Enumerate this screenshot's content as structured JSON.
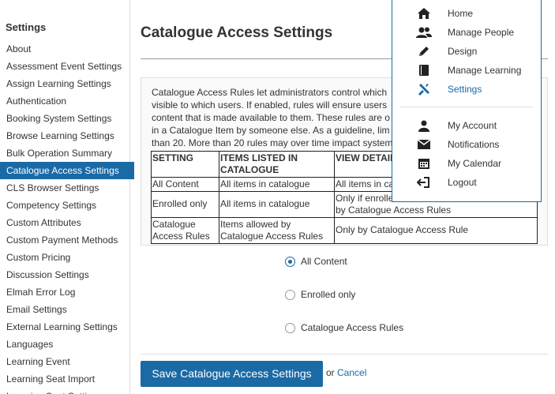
{
  "sidebar": {
    "title": "Settings",
    "items": [
      {
        "label": "About"
      },
      {
        "label": "Assessment Event Settings"
      },
      {
        "label": "Assign Learning Settings"
      },
      {
        "label": "Authentication"
      },
      {
        "label": "Booking System Settings"
      },
      {
        "label": "Browse Learning Settings"
      },
      {
        "label": "Bulk Operation Summary"
      },
      {
        "label": "Catalogue Access Settings",
        "active": true
      },
      {
        "label": "CLS Browser Settings"
      },
      {
        "label": "Competency Settings"
      },
      {
        "label": "Custom Attributes"
      },
      {
        "label": "Custom Payment Methods"
      },
      {
        "label": "Custom Pricing"
      },
      {
        "label": "Discussion Settings"
      },
      {
        "label": "Elmah Error Log"
      },
      {
        "label": "Email Settings"
      },
      {
        "label": "External Learning Settings"
      },
      {
        "label": "Languages"
      },
      {
        "label": "Learning Event"
      },
      {
        "label": "Learning Seat Import"
      },
      {
        "label": "Learning Seat Settings"
      }
    ]
  },
  "main": {
    "title": "Catalogue Access Settings",
    "info_lines": [
      "Catalogue Access Rules let administrators control which",
      "visible to which users. If enabled, rules will ensure users",
      "content that is made available to them. These rules are o",
      "in a Catalogue Item by someone else. As a guideline, lim",
      "than 20. More than 20 rules may over time impact system"
    ],
    "table": {
      "headers": [
        "SETTING",
        "ITEMS LISTED IN CATALOGUE",
        "VIEW DETAIL"
      ],
      "rows": [
        {
          "setting": "All Content",
          "items": "All items in catalogue",
          "view": [
            "All items in ca"
          ]
        },
        {
          "setting": "Enrolled only",
          "items": "All items in catalogue",
          "view": [
            "Only if enrolle",
            "by Catalogue Access Rules"
          ]
        },
        {
          "setting": "Catalogue Access Rules",
          "items": "Items allowed by Catalogue Access Rules",
          "view": [
            "Only by Catalogue Access Rule"
          ]
        }
      ]
    },
    "options": [
      {
        "label": "All Content",
        "checked": true
      },
      {
        "label": "Enrolled only",
        "checked": false
      },
      {
        "label": "Catalogue Access Rules",
        "checked": false
      }
    ],
    "save_label": "Save Catalogue Access Settings",
    "or_text": "or",
    "cancel_label": "Cancel"
  },
  "menu": {
    "items": [
      {
        "label": "Home",
        "icon": "home-icon"
      },
      {
        "label": "Manage People",
        "icon": "users-icon"
      },
      {
        "label": "Design",
        "icon": "pencil-icon"
      },
      {
        "label": "Manage Learning",
        "icon": "book-icon"
      },
      {
        "label": "Settings",
        "icon": "wrench-icon",
        "active": true
      },
      {
        "label": "My Account",
        "icon": "user-icon"
      },
      {
        "label": "Notifications",
        "icon": "envelope-icon"
      },
      {
        "label": "My Calendar",
        "icon": "calendar-icon"
      },
      {
        "label": "Logout",
        "icon": "logout-icon"
      }
    ]
  },
  "colors": {
    "accent": "#1a6aa6",
    "text": "#333333"
  }
}
